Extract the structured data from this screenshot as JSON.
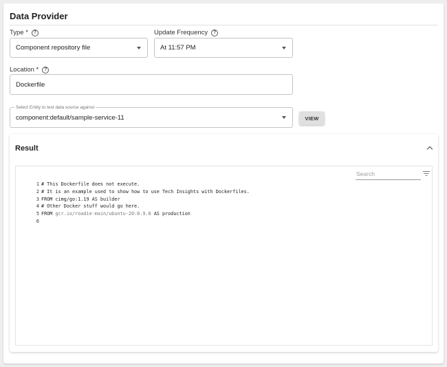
{
  "panel": {
    "title": "Data Provider"
  },
  "type_field": {
    "label": "Type *",
    "value": "Component repository file"
  },
  "frequency_field": {
    "label": "Update Frequency",
    "value": "At 11:57 PM"
  },
  "location_field": {
    "label": "Location *",
    "value": "Dockerfile"
  },
  "entity_field": {
    "label": "Select Entity to test data source against",
    "value": "component:default/sample-service-11"
  },
  "view_button": {
    "label": "VIEW"
  },
  "result": {
    "title": "Result",
    "search_placeholder": "Search",
    "lines": [
      {
        "num": "1",
        "text": "# This Dockerfile does not execute."
      },
      {
        "num": "2",
        "text": "# It is an example used to show how to use Tech Insights with Dockerfiles."
      },
      {
        "num": "3",
        "text": "FROM cimg/go:1.19 AS builder"
      },
      {
        "num": "4",
        "text": "# Other Docker stuff would go here."
      },
      {
        "num": "5",
        "pre": "FROM ",
        "muted": "gcr.io/roadie-main/ubuntu-20:0.9.8",
        "post": " AS production"
      },
      {
        "num": "6",
        "text": ""
      }
    ]
  },
  "icons": {
    "help": "help-circle-icon",
    "dropdown": "chevron-down-icon",
    "collapse": "chevron-up-icon",
    "filter": "filter-icon"
  }
}
